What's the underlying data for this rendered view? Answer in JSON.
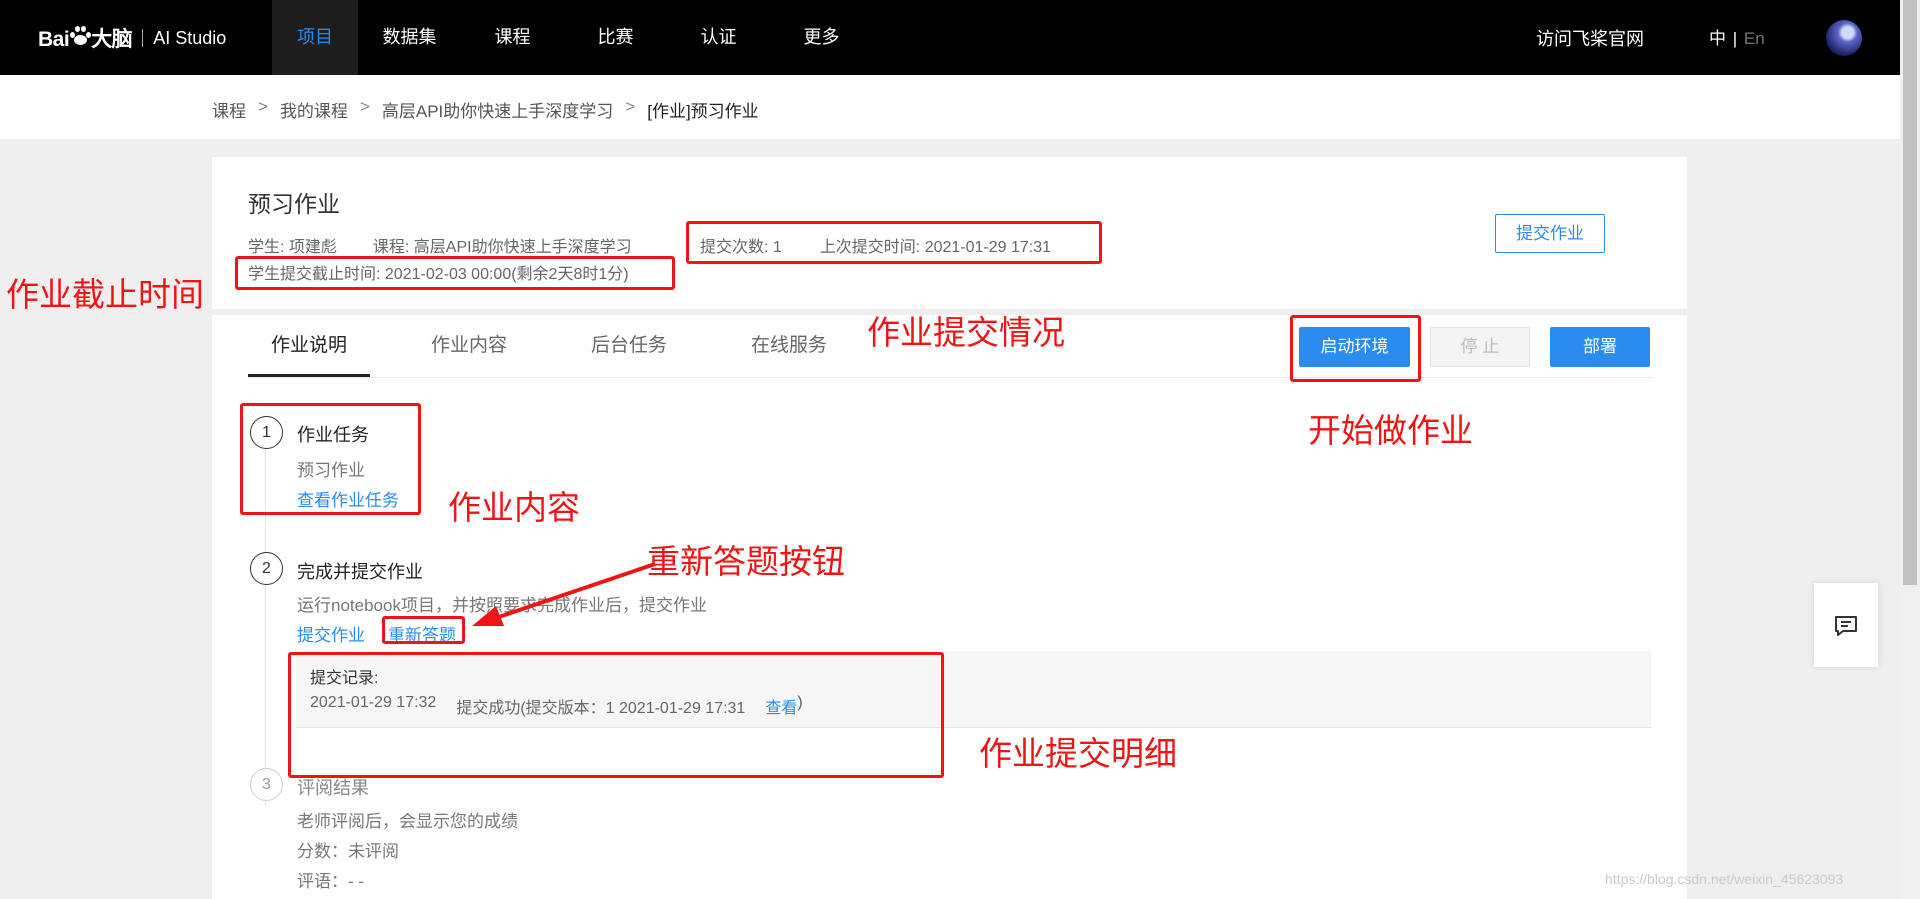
{
  "nav": {
    "logo_text": "Bai",
    "logo_suffix": "大脑",
    "logo_studio": "AI Studio",
    "items": [
      "项目",
      "数据集",
      "课程",
      "比赛",
      "认证",
      "更多"
    ],
    "visit": "访问飞桨官网",
    "lang_zh": "中",
    "lang_sep": "|",
    "lang_en": "En"
  },
  "breadcrumb": {
    "items": [
      "课程",
      "我的课程",
      "高层API助你快速上手深度学习",
      "[作业]预习作业"
    ],
    "sep": ">"
  },
  "header": {
    "title": "预习作业",
    "student": "学生: 项建彪",
    "course": "课程: 高层API助你快速上手深度学习",
    "deadline": "学生提交截止时间: 2021-02-03 00:00(剩余2天8时1分)",
    "submit_count": "提交次数: 1",
    "last_submit": "上次提交时间: 2021-01-29 17:31",
    "submit_button": "提交作业"
  },
  "tabs": [
    "作业说明",
    "作业内容",
    "后台任务",
    "在线服务"
  ],
  "actions": {
    "start": "启动环境",
    "stop": "停 止",
    "deploy": "部署"
  },
  "steps": [
    {
      "num": "1",
      "title": "作业任务",
      "desc": "预习作业",
      "link": "查看作业任务"
    },
    {
      "num": "2",
      "title": "完成并提交作业",
      "desc": "运行notebook项目，并按照要求完成作业后，提交作业",
      "link_submit": "提交作业",
      "link_redo": "重新答题",
      "record_title": "提交记录:",
      "record_time": "2021-01-29 17:32",
      "record_status": "提交成功(提交版本：1 2021-01-29 17:31",
      "record_view": "查看",
      "record_close": ")"
    },
    {
      "num": "3",
      "title": "评阅结果",
      "desc": "老师评阅后，会显示您的成绩",
      "score": "分数：未评阅",
      "comment": "评语：- -"
    }
  ],
  "annotations": {
    "deadline": "作业截止时间",
    "submit_status": "作业提交情况",
    "start_work": "开始做作业",
    "content": "作业内容",
    "redo_button": "重新答题按钮",
    "submit_detail": "作业提交明细"
  },
  "watermark": "https://blog.csdn.net/weixin_45623093",
  "colors": {
    "accent": "#2b8cf0",
    "annotation": "#f01515",
    "nav_bg": "#000000"
  }
}
